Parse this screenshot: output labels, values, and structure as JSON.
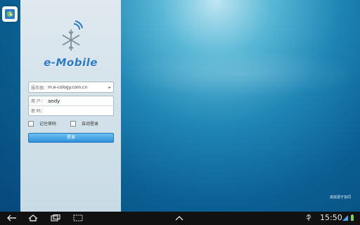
{
  "app": {
    "logo_text": "e-Mobile"
  },
  "form": {
    "server_label": "服务器：",
    "server_value": "m.e-cology.com.cn",
    "user_label": "用 户：",
    "user_value": "andy",
    "password_label": "密 码：",
    "remember_label": "记住密码",
    "auto_login_label": "自动登录",
    "login_button": "登录"
  },
  "watermark": "高效源于协同",
  "system": {
    "time": "15:50"
  },
  "colors": {
    "accent": "#2f8fd8"
  },
  "icons": {
    "back": "back-icon",
    "home": "home-icon",
    "recents": "recents-icon",
    "screenshot": "screenshot-icon",
    "up": "chevron-up-icon",
    "usb": "usb-icon",
    "wifi": "wifi-icon",
    "battery": "battery-icon",
    "app": "app-icon"
  }
}
